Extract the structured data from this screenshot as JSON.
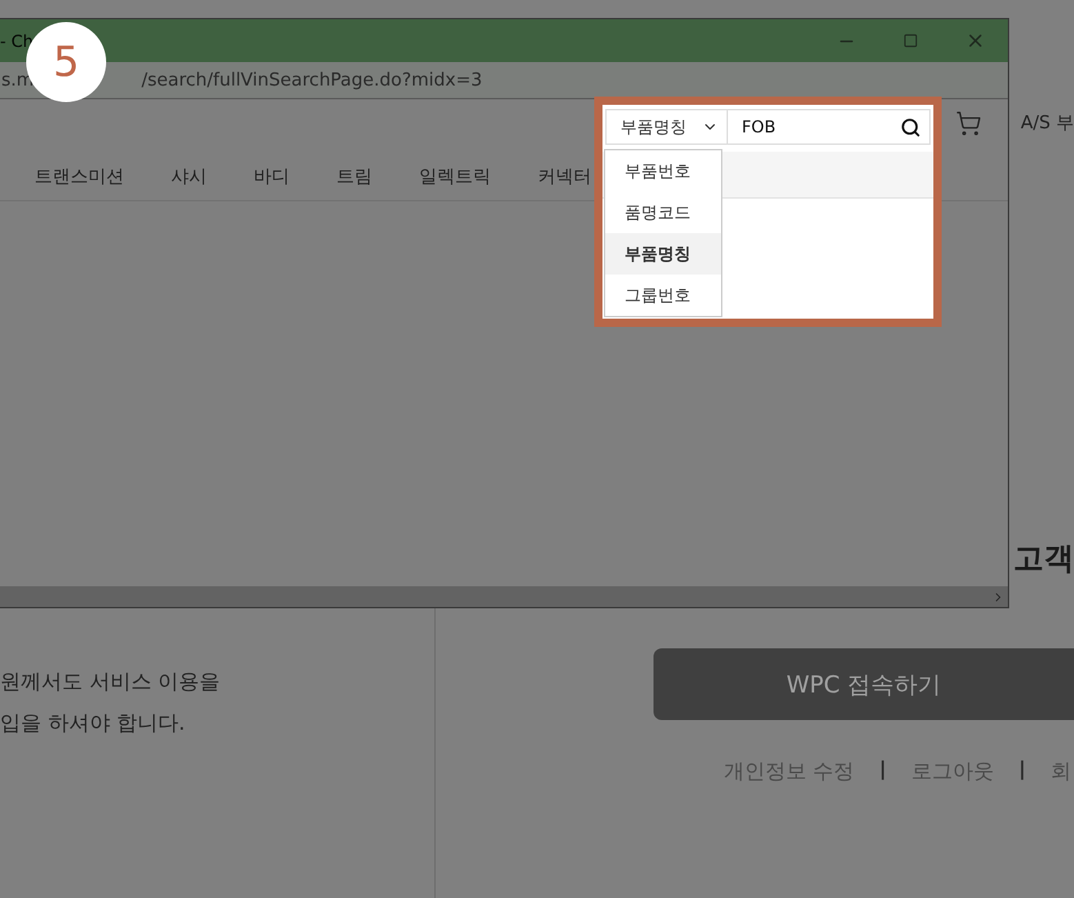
{
  "window": {
    "title": "- Ch",
    "address_start": "s.m",
    "address_end": "/search/fullVinSearchPage.do?midx=3"
  },
  "step_badge": "5",
  "nav": [
    "트랜스미션",
    "샤시",
    "바디",
    "트림",
    "일렉트릭",
    "커넥터"
  ],
  "search": {
    "field": "부품명칭",
    "value": "FOB",
    "options": [
      {
        "label": "부품번호",
        "selected": false
      },
      {
        "label": "품명코드",
        "selected": false
      },
      {
        "label": "부품명칭",
        "selected": true
      },
      {
        "label": "그룹번호",
        "selected": false
      }
    ]
  },
  "page": {
    "header_link": "A/S 부",
    "side_title": "고객",
    "notice_lines": [
      "원께서도 서비스 이용을",
      "입을 하셔야 합니다."
    ],
    "wpc_button": "WPC 접속하기",
    "links": [
      {
        "kind": "link",
        "label": "개인정보 수정"
      },
      {
        "kind": "separator",
        "label": "|"
      },
      {
        "kind": "link",
        "label": "로그아웃"
      },
      {
        "kind": "separator",
        "label": "|"
      },
      {
        "kind": "link",
        "label": "회"
      }
    ]
  }
}
